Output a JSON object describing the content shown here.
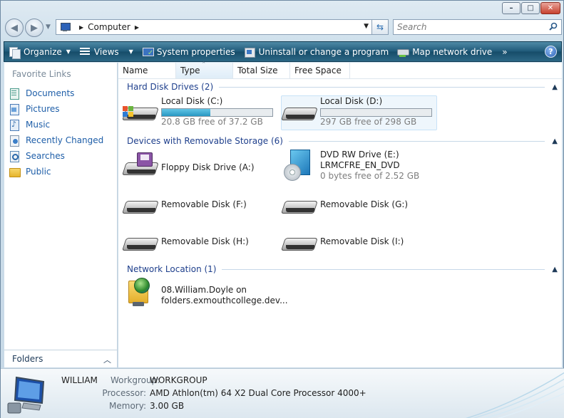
{
  "window": {
    "caption": {
      "minimize": "–",
      "maximize": "□",
      "close": "✕"
    }
  },
  "nav": {
    "address_path": [
      "Computer"
    ],
    "search_placeholder": "Search"
  },
  "toolbar": {
    "organize": "Organize",
    "views": "Views",
    "system_properties": "System properties",
    "uninstall": "Uninstall or change a program",
    "map_network_drive": "Map network drive",
    "more": "»",
    "help": "?"
  },
  "sidebar": {
    "heading": "Favorite Links",
    "items": [
      {
        "label": "Documents",
        "icon": "documents-icon"
      },
      {
        "label": "Pictures",
        "icon": "pictures-icon"
      },
      {
        "label": "Music",
        "icon": "music-icon"
      },
      {
        "label": "Recently Changed",
        "icon": "recently-changed-icon"
      },
      {
        "label": "Searches",
        "icon": "searches-icon"
      },
      {
        "label": "Public",
        "icon": "public-folder-icon"
      }
    ],
    "folders_label": "Folders"
  },
  "columns": [
    "Name",
    "Type",
    "Total Size",
    "Free Space"
  ],
  "groups": {
    "hard_disk": {
      "title": "Hard Disk Drives (2)",
      "drives": [
        {
          "name": "Local Disk (C:)",
          "free_text": "20.8 GB free of 37.2 GB",
          "used_fraction": 0.44
        },
        {
          "name": "Local Disk (D:)",
          "free_text": "297 GB free of 298 GB",
          "used_fraction": 0.003
        }
      ]
    },
    "removable": {
      "title": "Devices with Removable Storage (6)",
      "floppy": "Floppy Disk Drive (A:)",
      "dvd": {
        "name": "DVD RW Drive (E:)",
        "label": "LRMCFRE_EN_DVD",
        "free_text": "0 bytes free of 2.52 GB"
      },
      "disk_f": "Removable Disk (F:)",
      "disk_g": "Removable Disk (G:)",
      "disk_h": "Removable Disk (H:)",
      "disk_i": "Removable Disk (I:)"
    },
    "network": {
      "title": "Network Location (1)",
      "item_line1": "08.William.Doyle on",
      "item_line2": "folders.exmouthcollege.dev..."
    }
  },
  "details": {
    "computer_name": "WILLIAM",
    "workgroup_label": "Workgroup:",
    "workgroup": "WORKGROUP",
    "processor_label": "Processor:",
    "processor": "AMD Athlon(tm) 64 X2 Dual Core Processor 4000+",
    "memory_label": "Memory:",
    "memory": "3.00 GB"
  },
  "colors": {
    "link_blue": "#1e5ea8",
    "group_title": "#1e3f8c",
    "toolbar_bg": "#1e5878",
    "capacity_fill": "#2797c2"
  }
}
